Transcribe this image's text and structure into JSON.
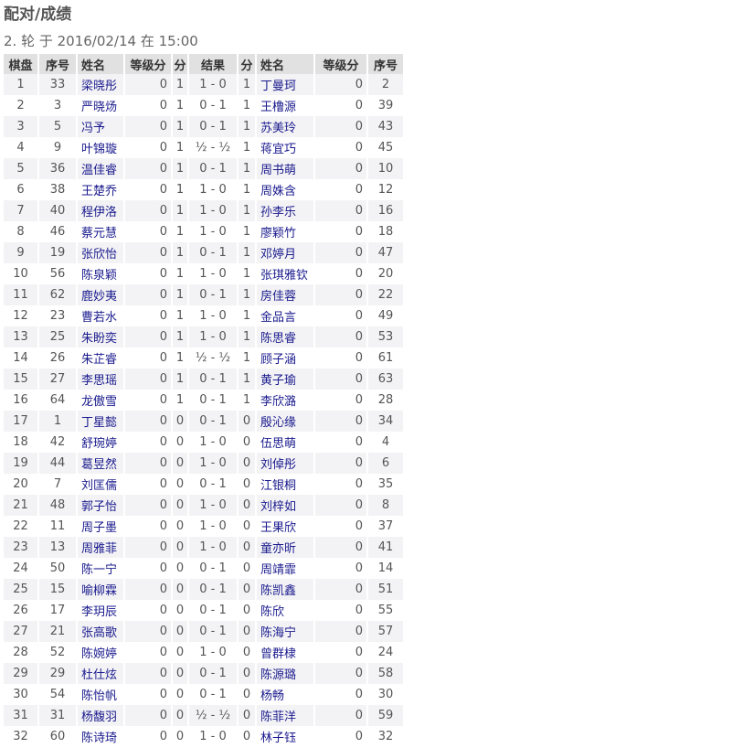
{
  "page": {
    "title": "配对/成绩",
    "round_info": "2. 轮 于 2016/02/14 在 15:00"
  },
  "table": {
    "headers": {
      "board": "棋盘",
      "white_no": "序号",
      "white_name": "姓名",
      "white_rating": "等级分",
      "white_pts": "分",
      "result": "结果",
      "black_pts": "分",
      "black_name": "姓名",
      "black_rating": "等级分",
      "black_no": "序号"
    },
    "rows": [
      {
        "board": "1",
        "wno": "33",
        "wname": "梁晓彤",
        "wrating": "0",
        "wpts": "1",
        "result": "1 - 0",
        "bpts": "1",
        "bname": "丁曼珂",
        "brating": "0",
        "bno": "2"
      },
      {
        "board": "2",
        "wno": "3",
        "wname": "严晓炀",
        "wrating": "0",
        "wpts": "1",
        "result": "0 - 1",
        "bpts": "1",
        "bname": "王橹源",
        "brating": "0",
        "bno": "39"
      },
      {
        "board": "3",
        "wno": "5",
        "wname": "冯予",
        "wrating": "0",
        "wpts": "1",
        "result": "0 - 1",
        "bpts": "1",
        "bname": "苏美玲",
        "brating": "0",
        "bno": "43"
      },
      {
        "board": "4",
        "wno": "9",
        "wname": "叶锦璇",
        "wrating": "0",
        "wpts": "1",
        "result": "½ - ½",
        "bpts": "1",
        "bname": "蒋宜巧",
        "brating": "0",
        "bno": "45"
      },
      {
        "board": "5",
        "wno": "36",
        "wname": "温佳睿",
        "wrating": "0",
        "wpts": "1",
        "result": "0 - 1",
        "bpts": "1",
        "bname": "周书萌",
        "brating": "0",
        "bno": "10"
      },
      {
        "board": "6",
        "wno": "38",
        "wname": "王楚乔",
        "wrating": "0",
        "wpts": "1",
        "result": "1 - 0",
        "bpts": "1",
        "bname": "周姝含",
        "brating": "0",
        "bno": "12"
      },
      {
        "board": "7",
        "wno": "40",
        "wname": "程伊洛",
        "wrating": "0",
        "wpts": "1",
        "result": "1 - 0",
        "bpts": "1",
        "bname": "孙李乐",
        "brating": "0",
        "bno": "16"
      },
      {
        "board": "8",
        "wno": "46",
        "wname": "蔡元慧",
        "wrating": "0",
        "wpts": "1",
        "result": "1 - 0",
        "bpts": "1",
        "bname": "廖颖竹",
        "brating": "0",
        "bno": "18"
      },
      {
        "board": "9",
        "wno": "19",
        "wname": "张欣怡",
        "wrating": "0",
        "wpts": "1",
        "result": "0 - 1",
        "bpts": "1",
        "bname": "邓婷月",
        "brating": "0",
        "bno": "47"
      },
      {
        "board": "10",
        "wno": "56",
        "wname": "陈泉颖",
        "wrating": "0",
        "wpts": "1",
        "result": "1 - 0",
        "bpts": "1",
        "bname": "张琪雅钦",
        "brating": "0",
        "bno": "20"
      },
      {
        "board": "11",
        "wno": "62",
        "wname": "鹿妙夷",
        "wrating": "0",
        "wpts": "1",
        "result": "0 - 1",
        "bpts": "1",
        "bname": "房佳蓉",
        "brating": "0",
        "bno": "22"
      },
      {
        "board": "12",
        "wno": "23",
        "wname": "曹若水",
        "wrating": "0",
        "wpts": "1",
        "result": "1 - 0",
        "bpts": "1",
        "bname": "金品言",
        "brating": "0",
        "bno": "49"
      },
      {
        "board": "13",
        "wno": "25",
        "wname": "朱盼奕",
        "wrating": "0",
        "wpts": "1",
        "result": "1 - 0",
        "bpts": "1",
        "bname": "陈思睿",
        "brating": "0",
        "bno": "53"
      },
      {
        "board": "14",
        "wno": "26",
        "wname": "朱芷睿",
        "wrating": "0",
        "wpts": "1",
        "result": "½ - ½",
        "bpts": "1",
        "bname": "顾子涵",
        "brating": "0",
        "bno": "61"
      },
      {
        "board": "15",
        "wno": "27",
        "wname": "李思瑶",
        "wrating": "0",
        "wpts": "1",
        "result": "0 - 1",
        "bpts": "1",
        "bname": "黄子瑜",
        "brating": "0",
        "bno": "63"
      },
      {
        "board": "16",
        "wno": "64",
        "wname": "龙傲雪",
        "wrating": "0",
        "wpts": "1",
        "result": "0 - 1",
        "bpts": "1",
        "bname": "李欣潞",
        "brating": "0",
        "bno": "28"
      },
      {
        "board": "17",
        "wno": "1",
        "wname": "丁星懿",
        "wrating": "0",
        "wpts": "0",
        "result": "0 - 1",
        "bpts": "0",
        "bname": "殷沁缘",
        "brating": "0",
        "bno": "34"
      },
      {
        "board": "18",
        "wno": "42",
        "wname": "舒琬婷",
        "wrating": "0",
        "wpts": "0",
        "result": "1 - 0",
        "bpts": "0",
        "bname": "伍思萌",
        "brating": "0",
        "bno": "4"
      },
      {
        "board": "19",
        "wno": "44",
        "wname": "葛昱然",
        "wrating": "0",
        "wpts": "0",
        "result": "1 - 0",
        "bpts": "0",
        "bname": "刘倬彤",
        "brating": "0",
        "bno": "6"
      },
      {
        "board": "20",
        "wno": "7",
        "wname": "刘匡儒",
        "wrating": "0",
        "wpts": "0",
        "result": "0 - 1",
        "bpts": "0",
        "bname": "江银桐",
        "brating": "0",
        "bno": "35"
      },
      {
        "board": "21",
        "wno": "48",
        "wname": "郭子怡",
        "wrating": "0",
        "wpts": "0",
        "result": "1 - 0",
        "bpts": "0",
        "bname": "刘梓如",
        "brating": "0",
        "bno": "8"
      },
      {
        "board": "22",
        "wno": "11",
        "wname": "周子墨",
        "wrating": "0",
        "wpts": "0",
        "result": "1 - 0",
        "bpts": "0",
        "bname": "王果欣",
        "brating": "0",
        "bno": "37"
      },
      {
        "board": "23",
        "wno": "13",
        "wname": "周雅菲",
        "wrating": "0",
        "wpts": "0",
        "result": "1 - 0",
        "bpts": "0",
        "bname": "童亦昕",
        "brating": "0",
        "bno": "41"
      },
      {
        "board": "24",
        "wno": "50",
        "wname": "陈一宁",
        "wrating": "0",
        "wpts": "0",
        "result": "0 - 1",
        "bpts": "0",
        "bname": "周靖霏",
        "brating": "0",
        "bno": "14"
      },
      {
        "board": "25",
        "wno": "15",
        "wname": "喻柳霖",
        "wrating": "0",
        "wpts": "0",
        "result": "0 - 1",
        "bpts": "0",
        "bname": "陈凯鑫",
        "brating": "0",
        "bno": "51"
      },
      {
        "board": "26",
        "wno": "17",
        "wname": "李玥辰",
        "wrating": "0",
        "wpts": "0",
        "result": "0 - 1",
        "bpts": "0",
        "bname": "陈欣",
        "brating": "0",
        "bno": "55"
      },
      {
        "board": "27",
        "wno": "21",
        "wname": "张高歌",
        "wrating": "0",
        "wpts": "0",
        "result": "0 - 1",
        "bpts": "0",
        "bname": "陈海宁",
        "brating": "0",
        "bno": "57"
      },
      {
        "board": "28",
        "wno": "52",
        "wname": "陈婉婷",
        "wrating": "0",
        "wpts": "0",
        "result": "1 - 0",
        "bpts": "0",
        "bname": "曾群棣",
        "brating": "0",
        "bno": "24"
      },
      {
        "board": "29",
        "wno": "29",
        "wname": "杜仕炫",
        "wrating": "0",
        "wpts": "0",
        "result": "0 - 1",
        "bpts": "0",
        "bname": "陈源璐",
        "brating": "0",
        "bno": "58"
      },
      {
        "board": "30",
        "wno": "54",
        "wname": "陈怡帆",
        "wrating": "0",
        "wpts": "0",
        "result": "0 - 1",
        "bpts": "0",
        "bname": "杨畅",
        "brating": "0",
        "bno": "30"
      },
      {
        "board": "31",
        "wno": "31",
        "wname": "杨馥羽",
        "wrating": "0",
        "wpts": "0",
        "result": "½ - ½",
        "bpts": "0",
        "bname": "陈菲洋",
        "brating": "0",
        "bno": "59"
      },
      {
        "board": "32",
        "wno": "60",
        "wname": "陈诗琦",
        "wrating": "0",
        "wpts": "0",
        "result": "1 - 0",
        "bpts": "0",
        "bname": "林子钰",
        "brating": "0",
        "bno": "32"
      }
    ]
  }
}
